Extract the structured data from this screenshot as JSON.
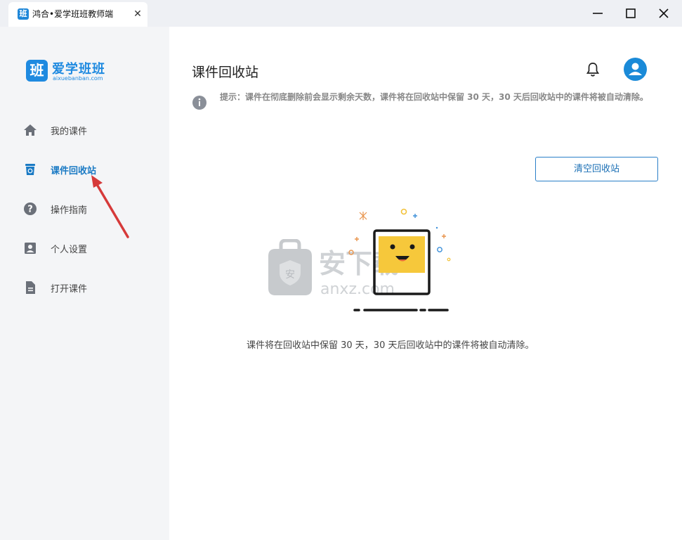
{
  "window": {
    "tab_title": "鸿合•爱学班班教师端",
    "tab_icon_text": "班"
  },
  "brand": {
    "logo_char": "班",
    "name": "爱学班班",
    "sub": "aixuebanban.com",
    "color": "#1f8ae0"
  },
  "sidebar": {
    "items": [
      {
        "label": "我的课件",
        "icon": "home-icon"
      },
      {
        "label": "课件回收站",
        "icon": "trash-icon",
        "active": true
      },
      {
        "label": "操作指南",
        "icon": "help-icon"
      },
      {
        "label": "个人设置",
        "icon": "user-card-icon"
      },
      {
        "label": "打开课件",
        "icon": "document-icon"
      }
    ]
  },
  "main": {
    "title": "课件回收站",
    "tip": "提示：课件在彻底删除前会显示剩余天数，课件将在回收站中保留 30 天，30 天后回收站中的课件将被自动清除。",
    "clear_button": "清空回收站",
    "empty_message": "课件将在回收站中保留 30 天，30 天后回收站中的课件将被自动清除。"
  },
  "watermark": {
    "text": "安下载",
    "sub": "anxz.com",
    "badge_char": "安"
  },
  "colors": {
    "accent": "#1f8ae0",
    "active_nav": "#1a7ac4",
    "annotation_arrow": "#d63a3a"
  }
}
